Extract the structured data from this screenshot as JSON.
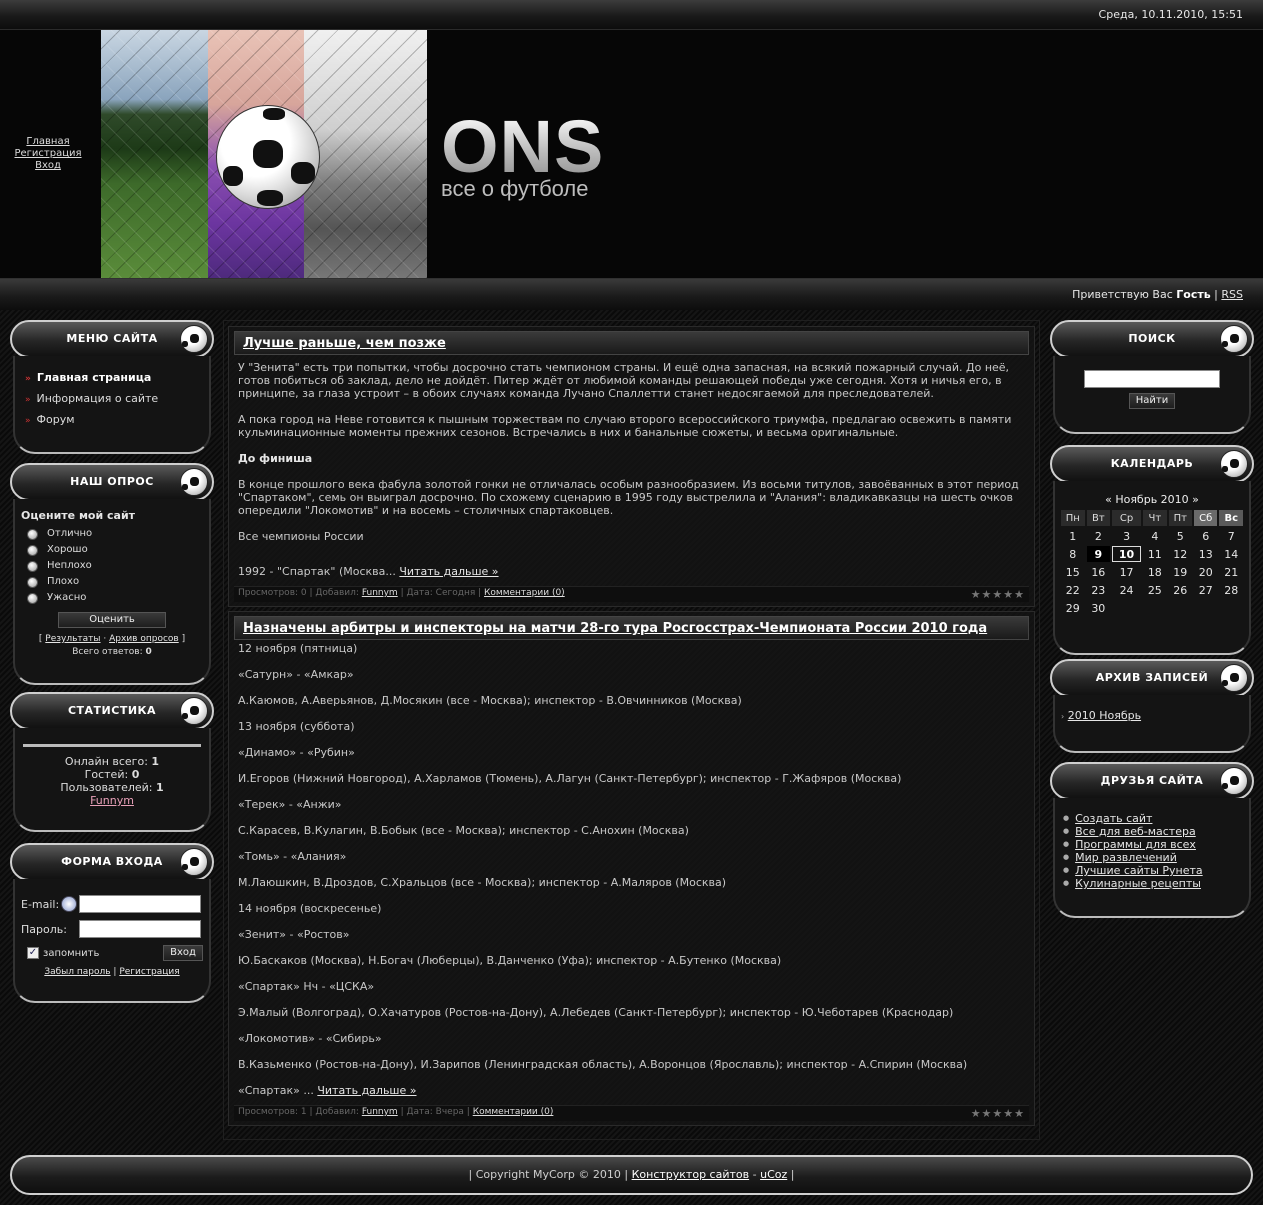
{
  "topbar": {
    "datetime": "Среда, 10.11.2010, 15:51"
  },
  "header": {
    "links": [
      "Главная",
      "Регистрация",
      "Вход"
    ],
    "brand_name": "ONS",
    "brand_tagline": "все о футболе"
  },
  "greeting": {
    "prefix": "Приветствую Вас",
    "user": "Гость",
    "sep": "|",
    "rss": "RSS"
  },
  "menu": {
    "title": "МЕНЮ САЙТА",
    "items": [
      "Главная страница",
      "Информация о сайте",
      "Форум"
    ]
  },
  "poll": {
    "title": "НАШ ОПРОС",
    "question": "Оцените мой сайт",
    "options": [
      "Отлично",
      "Хорошо",
      "Неплохо",
      "Плохо",
      "Ужасно"
    ],
    "vote_button": "Оценить",
    "results_link": "Результаты",
    "archive_link": "Архив опросов",
    "total_label": "Всего ответов:",
    "total_value": "0"
  },
  "stats": {
    "title": "СТАТИСТИКА",
    "online_label": "Онлайн всего:",
    "online_value": "1",
    "guests_label": "Гостей:",
    "guests_value": "0",
    "users_label": "Пользователей:",
    "users_value": "1",
    "user_link": "Funnym"
  },
  "login": {
    "title": "ФОРМА ВХОДА",
    "email_label": "E-mail:",
    "password_label": "Пароль:",
    "remember_label": "запомнить",
    "login_button": "Вход",
    "forgot_link": "Забыл пароль",
    "register_link": "Регистрация"
  },
  "entries": [
    {
      "title": "Лучше раньше, чем позже",
      "paragraphs": [
        "У \"Зенита\" есть три попытки, чтобы досрочно стать чемпионом страны. И ещё одна запасная, на всякий пожарный случай. До неё, готов побиться об заклад, дело не дойдёт. Питер ждёт от любимой команды решающей победы уже сегодня. Хотя и ничья его, в принципе, за глаза устроит – в обоих случаях команда Лучано Спаллетти станет недосягаемой для преследователей.",
        "А пока город на Неве готовится к пышным торжествам по случаю второго всероссийского триумфа, предлагаю освежить в памяти кульминационные моменты прежних сезонов. Встречались в них и банальные сюжеты, и весьма оригинальные.",
        "До финиша",
        "В конце прошлого века фабула золотой гонки не отличалась особым разнообразием. Из восьми титулов, завоёванных в этот период \"Спартаком\", семь он выиграл досрочно. По схожему сценарию в 1995 году выстрелила и \"Алания\": владикавказцы на шесть очков опередили \"Локомотив\" и на восемь – столичных спартаковцев.",
        "Все чемпионы России"
      ],
      "teaser": "1992 - \"Спартак\" (Москва...",
      "read_more": "Читать дальше »",
      "meta_views": "Просмотров: 0",
      "meta_added": "Добавил:",
      "meta_author": "Funnym",
      "meta_date": "Дата: Сегодня",
      "meta_comments": "Комментарии (0)"
    },
    {
      "title": "Назначены арбитры и инспекторы на матчи 28-го тура Росгосстрах-Чемпионата России 2010 года",
      "paragraphs": [
        "12 ноября (пятница)",
        "«Сатурн» - «Амкар»",
        "А.Каюмов, А.Аверьянов, Д.Мосякин (все - Москва); инспектор - В.Овчинников (Москва)",
        "13 ноября (суббота)",
        "«Динамо» - «Рубин»",
        "И.Егоров (Нижний Новгород), А.Харламов (Тюмень), А.Лагун (Санкт-Петербург); инспектор - Г.Жафяров (Москва)",
        "«Терек» - «Анжи»",
        "С.Карасев, В.Кулагин, В.Бобык (все - Москва); инспектор - С.Анохин (Москва)",
        "«Томь» - «Алания»",
        "М.Лаюшкин, В.Дроздов, С.Хральцов (все - Москва); инспектор - А.Маляров (Москва)",
        "14 ноября (воскресенье)",
        "«Зенит» - «Ростов»",
        "Ю.Баскаков (Москва), Н.Богач (Люберцы), В.Данченко (Уфа); инспектор - А.Бутенко (Москва)",
        "«Спартак» Нч - «ЦСКА»",
        "Э.Малый (Волгоград), О.Хачатуров (Ростов-на-Дону), А.Лебедев (Санкт-Петербург); инспектор - Ю.Чеботарев (Краснодар)",
        "«Локомотив» - «Сибирь»",
        "В.Казьменко (Ростов-на-Дону), И.Зарипов (Ленинградская область), А.Воронцов (Ярославль); инспектор - А.Спирин (Москва)"
      ],
      "teaser": "«Спартак» ...",
      "read_more": "Читать дальше »",
      "meta_views": "Просмотров: 1",
      "meta_added": "Добавил:",
      "meta_author": "Funnym",
      "meta_date": "Дата: Вчера",
      "meta_comments": "Комментарии (0)"
    }
  ],
  "search": {
    "title": "ПОИСК",
    "button": "Найти",
    "value": ""
  },
  "calendar": {
    "title": "КАЛЕНДАРЬ",
    "prev": "«",
    "month": "Ноябрь 2010",
    "next": "»",
    "weekdays": [
      "Пн",
      "Вт",
      "Ср",
      "Чт",
      "Пт",
      "Сб",
      "Вс"
    ],
    "weeks": [
      [
        "1",
        "2",
        "3",
        "4",
        "5",
        "6",
        "7"
      ],
      [
        "8",
        "9",
        "10",
        "11",
        "12",
        "13",
        "14"
      ],
      [
        "15",
        "16",
        "17",
        "18",
        "19",
        "20",
        "21"
      ],
      [
        "22",
        "23",
        "24",
        "25",
        "26",
        "27",
        "28"
      ],
      [
        "29",
        "30",
        "",
        "",
        "",
        "",
        ""
      ]
    ]
  },
  "archive": {
    "title": "АРХИВ ЗАПИСЕЙ",
    "items": [
      "2010 Ноябрь"
    ]
  },
  "friends": {
    "title": "ДРУЗЬЯ САЙТА",
    "items": [
      "Создать сайт",
      "Все для веб-мастера",
      "Программы для всех",
      "Мир развлечений",
      "Лучшие сайты Рунета",
      "Кулинарные рецепты"
    ]
  },
  "footer": {
    "copyright": "Copyright MyCorp © 2010",
    "constructor_link": "Конструктор сайтов",
    "dash": "-",
    "ucoz_link": "uCoz"
  }
}
